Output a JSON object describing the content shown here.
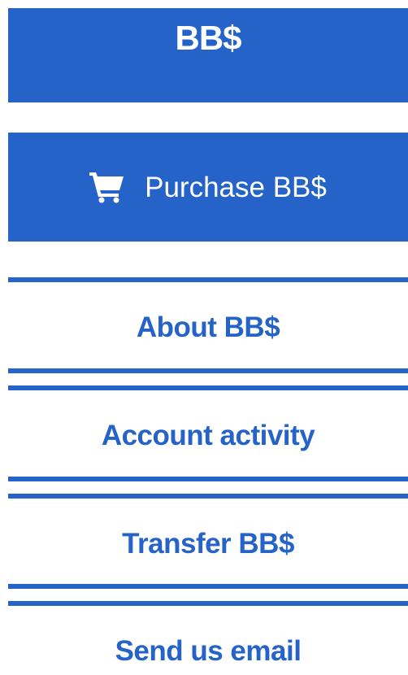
{
  "header": {
    "title": "BB$"
  },
  "purchase": {
    "label": "Purchase BB$",
    "icon": "shopping-cart-icon"
  },
  "menu": {
    "items": [
      {
        "label": "About BB$"
      },
      {
        "label": "Account activity"
      },
      {
        "label": "Transfer BB$"
      },
      {
        "label": "Send us email"
      }
    ]
  },
  "colors": {
    "brand": "#2563c9",
    "background": "#ffffff",
    "button_text": "#ffffff"
  }
}
